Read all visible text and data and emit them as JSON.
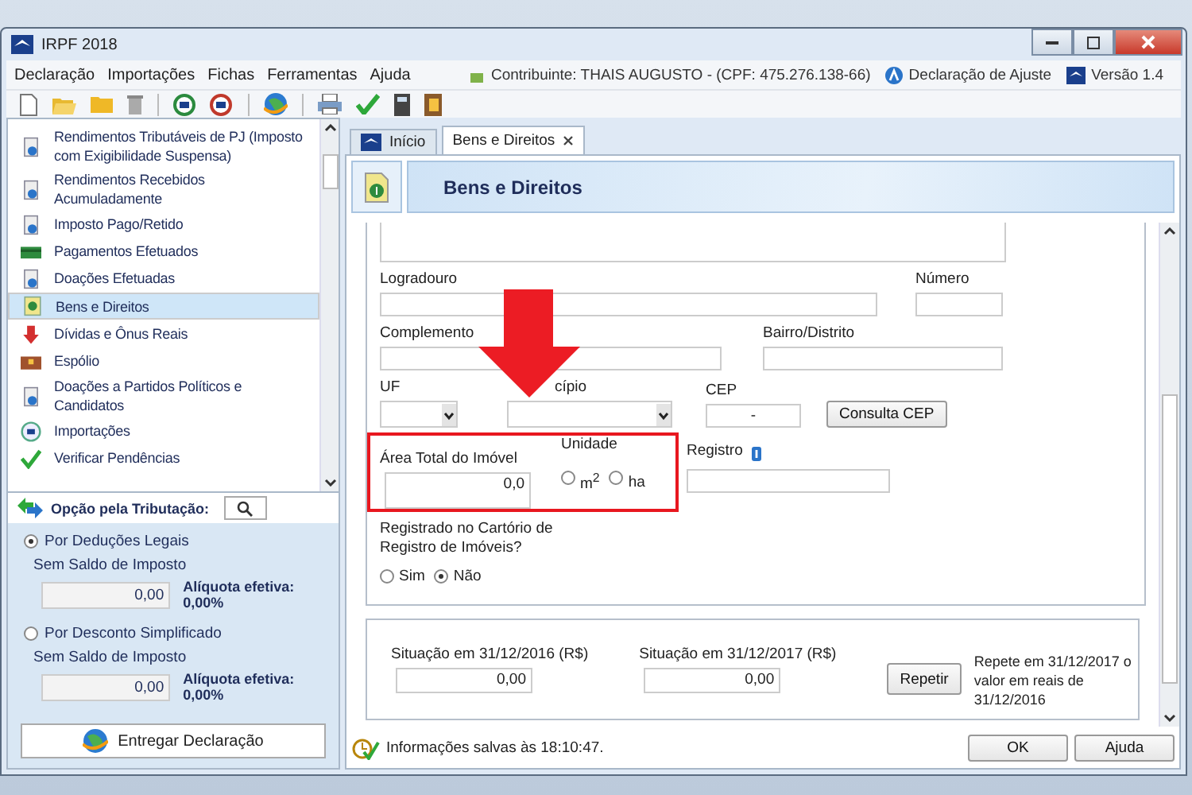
{
  "window": {
    "title": "IRPF 2018"
  },
  "menu": [
    "Declaração",
    "Importações",
    "Fichas",
    "Ferramentas",
    "Ajuda"
  ],
  "info": {
    "taxpayer": "Contribuinte: THAIS AUGUSTO - (CPF: 475.276.138-66)",
    "mode": "Declaração de Ajuste",
    "version": "Versão 1.4"
  },
  "sidebar": {
    "items": [
      {
        "label": "Rendimentos Tributáveis de PJ (Imposto com Exigibilidade Suspensa)",
        "selected": false
      },
      {
        "label": "Rendimentos Recebidos Acumuladamente",
        "selected": false
      },
      {
        "label": "Imposto Pago/Retido",
        "selected": false
      },
      {
        "label": "Pagamentos Efetuados",
        "selected": false
      },
      {
        "label": "Doações Efetuadas",
        "selected": false
      },
      {
        "label": "Bens e Direitos",
        "selected": true
      },
      {
        "label": "Dívidas e Ônus Reais",
        "selected": false
      },
      {
        "label": "Espólio",
        "selected": false
      },
      {
        "label": "Doações a Partidos Políticos e Candidatos",
        "selected": false
      },
      {
        "label": "Importações",
        "selected": false
      },
      {
        "label": "Verificar Pendências",
        "selected": false
      }
    ]
  },
  "tax_option": {
    "title": "Opção pela Tributação:",
    "options": [
      {
        "label": "Por Deduções Legais",
        "selected": true,
        "caption": "Sem Saldo de Imposto",
        "value": "0,00",
        "rate": "Alíquota efetiva: 0,00%"
      },
      {
        "label": "Por Desconto Simplificado",
        "selected": false,
        "caption": "Sem Saldo de Imposto",
        "value": "0,00",
        "rate": "Alíquota efetiva: 0,00%"
      }
    ]
  },
  "submit_button": "Entregar Declaração",
  "tabs": [
    {
      "label": "Início",
      "selected": false,
      "closable": false
    },
    {
      "label": "Bens e Direitos",
      "selected": true,
      "closable": true
    }
  ],
  "header": {
    "title": "Bens e Direitos"
  },
  "form": {
    "street": {
      "label": "Logradouro"
    },
    "number": {
      "label": "Número"
    },
    "complement": {
      "label": "Complemento"
    },
    "district": {
      "label": "Bairro/Distrito"
    },
    "state": {
      "label": "UF"
    },
    "city": {
      "label": "cípio"
    },
    "zip": {
      "label": "CEP",
      "value": "-"
    },
    "zip_button": "Consulta CEP",
    "area": {
      "label": "Área Total do Imóvel",
      "value": "0,0"
    },
    "unit": {
      "label": "Unidade",
      "options": [
        {
          "label": "m$^{2}$",
          "selected": false
        },
        {
          "label": "ha",
          "selected": false
        }
      ]
    },
    "registry": {
      "label": "Registro"
    },
    "registered": {
      "question": "Registrado no Cartório de Registro de Imóveis?",
      "options": [
        {
          "label": "Sim",
          "selected": false
        },
        {
          "label": "Não",
          "selected": true
        }
      ]
    },
    "values": [
      {
        "label": "Situação em 31/12/2016 (R$)",
        "value": "0,00"
      },
      {
        "label": "Situação em 31/12/2017 (R$)",
        "value": "0,00"
      }
    ],
    "repeat_button": "Repetir",
    "repeat_note": "Repete em 31/12/2017 o valor em reais de 31/12/2016"
  },
  "status": {
    "message": "Informações salvas às 18:10:47."
  },
  "buttons": [
    "OK",
    "Ajuda"
  ]
}
